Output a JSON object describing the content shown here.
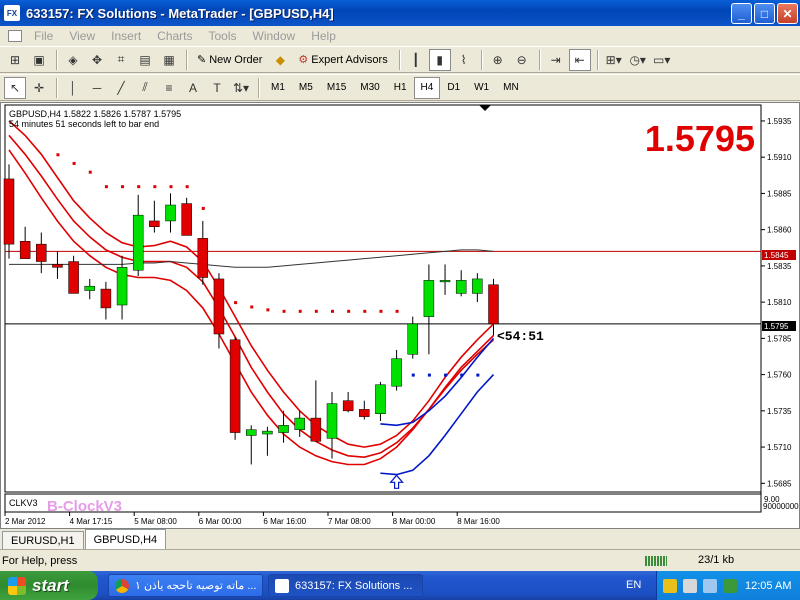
{
  "window": {
    "title": "633157: FX Solutions - MetaTrader - [GBPUSD,H4]",
    "app_icon": "FX"
  },
  "menu": {
    "items": [
      "File",
      "View",
      "Insert",
      "Charts",
      "Tools",
      "Window",
      "Help"
    ]
  },
  "toolbar1": {
    "new_order": "New Order",
    "expert_advisors": "Expert Advisors"
  },
  "toolbar2": {
    "tools": [
      "A"
    ],
    "timeframes": [
      "M1",
      "M5",
      "M15",
      "M30",
      "H1",
      "H4",
      "D1",
      "W1",
      "MN"
    ],
    "active_timeframe": "H4"
  },
  "chart": {
    "header_line": "GBPUSD,H4  1.5822 1.5826 1.5787 1.5795",
    "countdown_text": "54 minutes 51 seconds left to bar end",
    "big_price": "1.5795",
    "timer_label": "<54:51",
    "indicator_label": "CLKV3",
    "watermark": "B-ClockV3",
    "price_labels": [
      "1.5935",
      "1.5910",
      "1.5885",
      "1.5860",
      "1.5835",
      "1.5810",
      "1.5785",
      "1.5760",
      "1.5735",
      "1.5710",
      "1.5685"
    ],
    "marked_prices": {
      "upper_line": "1.5845",
      "current": "1.5795"
    },
    "subwindow_labels": [
      "9.00",
      "9000000000"
    ],
    "time_labels": [
      "2 Mar 2012",
      "4 Mar 17:15",
      "5 Mar 08:00",
      "6 Mar 00:00",
      "6 Mar 16:00",
      "7 Mar 08:00",
      "8 Mar 00:00",
      "8 Mar 16:00"
    ],
    "colors": {
      "bull": "#00E000",
      "bear": "#E00000",
      "band_red": "#E00000",
      "band_blue": "#0018C8",
      "big_price": "#E00000",
      "dots_red": "#E00000",
      "dots_blue": "#0018C8"
    }
  },
  "chart_data": {
    "type": "candlestick",
    "ylim": [
      1.5679,
      1.5946
    ],
    "candles": [
      {
        "o": 1.5895,
        "h": 1.5905,
        "l": 1.584,
        "c": 1.585
      },
      {
        "o": 1.5852,
        "h": 1.5862,
        "l": 1.584,
        "c": 1.584
      },
      {
        "o": 1.585,
        "h": 1.5858,
        "l": 1.583,
        "c": 1.5838
      },
      {
        "o": 1.5836,
        "h": 1.5845,
        "l": 1.5826,
        "c": 1.5834
      },
      {
        "o": 1.5838,
        "h": 1.5842,
        "l": 1.5818,
        "c": 1.5816
      },
      {
        "o": 1.5818,
        "h": 1.5826,
        "l": 1.5812,
        "c": 1.5821
      },
      {
        "o": 1.5819,
        "h": 1.5824,
        "l": 1.5798,
        "c": 1.5806
      },
      {
        "o": 1.5808,
        "h": 1.5842,
        "l": 1.5798,
        "c": 1.5834
      },
      {
        "o": 1.5832,
        "h": 1.5884,
        "l": 1.5828,
        "c": 1.587
      },
      {
        "o": 1.5866,
        "h": 1.588,
        "l": 1.5858,
        "c": 1.5862
      },
      {
        "o": 1.5866,
        "h": 1.5885,
        "l": 1.5858,
        "c": 1.5877
      },
      {
        "o": 1.5878,
        "h": 1.5882,
        "l": 1.5856,
        "c": 1.5856
      },
      {
        "o": 1.5854,
        "h": 1.5866,
        "l": 1.5822,
        "c": 1.5827
      },
      {
        "o": 1.5826,
        "h": 1.583,
        "l": 1.5778,
        "c": 1.5788
      },
      {
        "o": 1.5784,
        "h": 1.5786,
        "l": 1.5715,
        "c": 1.572
      },
      {
        "o": 1.5718,
        "h": 1.5725,
        "l": 1.5698,
        "c": 1.5722
      },
      {
        "o": 1.5719,
        "h": 1.5724,
        "l": 1.5704,
        "c": 1.5721
      },
      {
        "o": 1.572,
        "h": 1.5735,
        "l": 1.5713,
        "c": 1.5725
      },
      {
        "o": 1.5722,
        "h": 1.5735,
        "l": 1.5717,
        "c": 1.573
      },
      {
        "o": 1.573,
        "h": 1.5756,
        "l": 1.5718,
        "c": 1.5714
      },
      {
        "o": 1.5716,
        "h": 1.5748,
        "l": 1.5702,
        "c": 1.574
      },
      {
        "o": 1.5742,
        "h": 1.5748,
        "l": 1.5734,
        "c": 1.5735
      },
      {
        "o": 1.5736,
        "h": 1.5742,
        "l": 1.5729,
        "c": 1.5731
      },
      {
        "o": 1.5733,
        "h": 1.5755,
        "l": 1.5728,
        "c": 1.5753
      },
      {
        "o": 1.5752,
        "h": 1.5777,
        "l": 1.5749,
        "c": 1.5771
      },
      {
        "o": 1.5774,
        "h": 1.58,
        "l": 1.5771,
        "c": 1.5795
      },
      {
        "o": 1.58,
        "h": 1.5836,
        "l": 1.5774,
        "c": 1.5825
      },
      {
        "o": 1.5825,
        "h": 1.5836,
        "l": 1.5815,
        "c": 1.5825
      },
      {
        "o": 1.5816,
        "h": 1.5832,
        "l": 1.5814,
        "c": 1.5825
      },
      {
        "o": 1.5816,
        "h": 1.583,
        "l": 1.581,
        "c": 1.5826
      },
      {
        "o": 1.5822,
        "h": 1.5826,
        "l": 1.5787,
        "c": 1.5795
      }
    ],
    "envelopes": {
      "red_upper": [
        1.5935,
        1.5925,
        1.5912,
        1.5896,
        1.588,
        1.5868,
        1.5858,
        1.5851,
        1.5848,
        1.5849,
        1.5852,
        1.5848,
        1.5838,
        1.582,
        1.58,
        1.578,
        1.5763,
        1.5748,
        1.5735,
        1.5725,
        1.5718,
        1.5712,
        1.571,
        1.5712,
        1.5718,
        1.5728,
        1.5742,
        1.5758,
        1.5772,
        1.5784,
        1.5795
      ],
      "red_mid": [
        1.5925,
        1.5912,
        1.5897,
        1.5881,
        1.5866,
        1.5855,
        1.5846,
        1.5841,
        1.5838,
        1.5838,
        1.5838,
        1.5834,
        1.5824,
        1.5806,
        1.5786,
        1.5765,
        1.5748,
        1.5733,
        1.5722,
        1.5714,
        1.5708,
        1.5704,
        1.5703,
        1.5706,
        1.5713,
        1.5723,
        1.5736,
        1.5751,
        1.5765,
        1.5776,
        1.5787
      ],
      "red_lower": [
        1.5915,
        1.5899,
        1.5882,
        1.5866,
        1.5852,
        1.5842,
        1.5834,
        1.5829,
        1.5827,
        1.5827,
        1.5825,
        1.5818,
        1.5806,
        1.5788,
        1.5768,
        1.5748,
        1.5732,
        1.5719,
        1.571,
        1.5704,
        1.57,
        1.5698,
        1.5698,
        1.5702,
        1.571,
        1.5722,
        1.5736,
        1.575,
        1.5763,
        1.5774,
        1.5784
      ],
      "blue_upper_x": [
        23,
        24,
        25,
        26,
        27,
        28,
        29,
        30
      ],
      "blue_upper": [
        1.5726,
        1.5725,
        1.5727,
        1.5735,
        1.5745,
        1.5758,
        1.5772,
        1.5785
      ],
      "blue_lower_x": [
        23,
        24,
        25,
        26,
        27,
        28,
        29,
        30
      ],
      "blue_lower": [
        1.5692,
        1.5691,
        1.5694,
        1.5704,
        1.5718,
        1.5733,
        1.5748,
        1.576
      ]
    },
    "ma": [
      1.5836,
      1.5836,
      1.5836,
      1.5836,
      1.5836,
      1.5836,
      1.5836,
      1.5836,
      1.5837,
      1.5837,
      1.5838,
      1.5837,
      1.5836,
      1.5835,
      1.5834,
      1.5834,
      1.5834,
      1.5835,
      1.5836,
      1.5837,
      1.5838,
      1.5839,
      1.584,
      1.5841,
      1.5842,
      1.5843,
      1.5844,
      1.5845,
      1.5846,
      1.5846,
      1.5845
    ],
    "dots_red": [
      {
        "i": 6,
        "y": 1.589
      },
      {
        "i": 7,
        "y": 1.589
      },
      {
        "i": 8,
        "y": 1.589
      },
      {
        "i": 9,
        "y": 1.589
      },
      {
        "i": 10,
        "y": 1.589
      },
      {
        "i": 11,
        "y": 1.589
      },
      {
        "i": 3,
        "y": 1.5912
      },
      {
        "i": 4,
        "y": 1.5906
      },
      {
        "i": 5,
        "y": 1.59
      },
      {
        "i": 12,
        "y": 1.5875
      },
      {
        "i": 14,
        "y": 1.581
      },
      {
        "i": 15,
        "y": 1.5807
      },
      {
        "i": 16,
        "y": 1.5805
      },
      {
        "i": 17,
        "y": 1.5804
      },
      {
        "i": 18,
        "y": 1.5804
      },
      {
        "i": 19,
        "y": 1.5804
      },
      {
        "i": 20,
        "y": 1.5804
      },
      {
        "i": 21,
        "y": 1.5804
      },
      {
        "i": 22,
        "y": 1.5804
      },
      {
        "i": 23,
        "y": 1.5804
      },
      {
        "i": 24,
        "y": 1.5804
      }
    ],
    "dots_blue": [
      {
        "i": 25,
        "y": 1.576
      },
      {
        "i": 26,
        "y": 1.576
      },
      {
        "i": 27,
        "y": 1.576
      },
      {
        "i": 28,
        "y": 1.576
      },
      {
        "i": 29,
        "y": 1.576
      }
    ],
    "arrow_index": 24,
    "arrow_price": 1.5685,
    "hlines": [
      {
        "y": 1.5845,
        "color": "#C00000"
      },
      {
        "y": 1.5795,
        "color": "#000000"
      }
    ]
  },
  "tabs": [
    {
      "label": "EURUSD,H1"
    },
    {
      "label": "GBPUSD,H4",
      "active": true
    }
  ],
  "status": {
    "help": "For Help, press",
    "traffic": "23/1 kb"
  },
  "taskbar": {
    "start": "start",
    "tasks": [
      "ماته توصيه تاحجه ياذن ١ ...",
      "633157: FX Solutions ..."
    ],
    "lang": "EN",
    "clock": "12:05 AM"
  }
}
